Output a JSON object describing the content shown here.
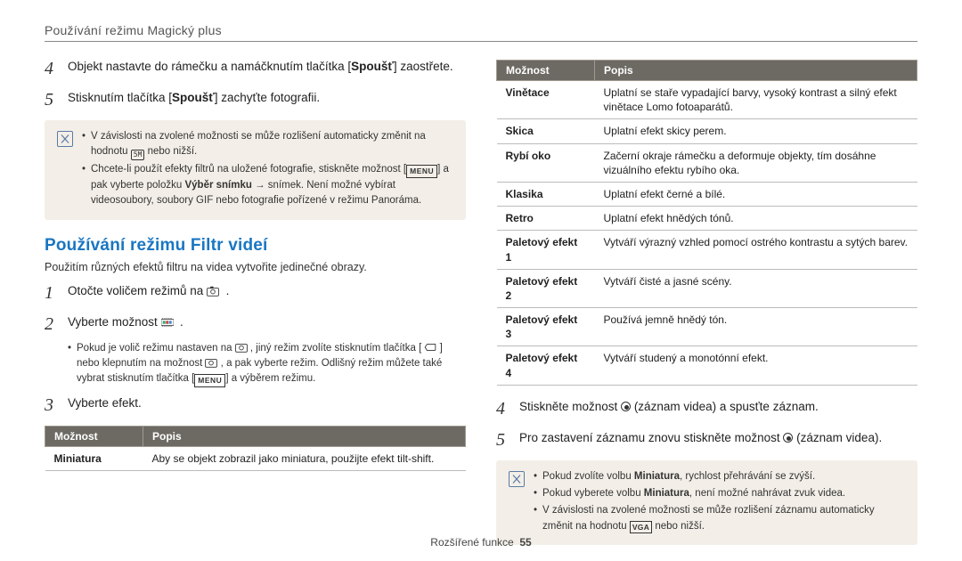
{
  "header": "Používání režimu Magický plus",
  "left": {
    "step4": {
      "pre": "Objekt nastavte do rámečku a namáčknutím tlačítka [",
      "bold": "Spoušť",
      "post": "] zaostřete."
    },
    "step5": {
      "pre": "Stisknutím tlačítka [",
      "bold": "Spoušť",
      "post": "] zachyťte fotografii."
    },
    "note1_a": "V závislosti na zvolené možnosti se může rozlišení automaticky změnit na hodnotu ",
    "note1_a_icon": "5M",
    "note1_a_post": " nebo nižší.",
    "note1_b_pre": "Chcete-li použít efekty filtrů na uložené fotografie, stiskněte možnost [",
    "note1_b_menu": "MENU",
    "note1_b_mid": "] a pak vyberte položku ",
    "note1_b_bold": "Výběr snímku",
    "note1_b_post": " → snímek. Není možné vybírat videosoubory, soubory GIF nebo fotografie pořízené v režimu Panoráma.",
    "section_title": "Používání režimu Filtr videí",
    "section_desc": "Použitím různých efektů filtru na videa vytvořite jedinečné obrazy.",
    "step1": "Otočte voličem režimů na ",
    "step2": "Vyberte možnost ",
    "step2_bullet": "Pokud je volič režimu nastaven na        , jiný režim zvolíte stisknutím tlačítka [        ] nebo klepnutím na možnost        , a pak vyberte režim. Odlišný režim můžete také vybrat stisknutím tlačítka [",
    "step2_bullet_menu": "MENU",
    "step2_bullet_post": "] a výběrem režimu.",
    "step3": "Vyberte efekt.",
    "table_h1": "Možnost",
    "table_h2": "Popis",
    "row_min_k": "Miniatura",
    "row_min_v": "Aby se objekt zobrazil jako miniatura, použijte efekt tilt-shift."
  },
  "right": {
    "table_h1": "Možnost",
    "table_h2": "Popis",
    "rows": [
      {
        "k": "Vinětace",
        "v": "Uplatní se staře vypadající barvy, vysoký kontrast a silný efekt vinětace Lomo fotoaparátů."
      },
      {
        "k": "Skica",
        "v": "Uplatní efekt skicy perem."
      },
      {
        "k": "Rybí oko",
        "v": "Začerní okraje rámečku a deformuje objekty, tím dosáhne vizuálního efektu rybího oka."
      },
      {
        "k": "Klasika",
        "v": "Uplatní efekt černé a bílé."
      },
      {
        "k": "Retro",
        "v": "Uplatní efekt hnědých tónů."
      },
      {
        "k": "Paletový efekt 1",
        "v": "Vytváří výrazný vzhled pomocí ostrého kontrastu a sytých barev."
      },
      {
        "k": "Paletový efekt 2",
        "v": "Vytváří čisté a jasné scény."
      },
      {
        "k": "Paletový efekt 3",
        "v": "Používá jemně hnědý tón."
      },
      {
        "k": "Paletový efekt 4",
        "v": "Vytváří studený a monotónní efekt."
      }
    ],
    "step4_pre": "Stiskněte možnost ",
    "step4_post": " (záznam videa) a spusťte záznam.",
    "step5_pre": "Pro zastavení záznamu znovu stiskněte možnost ",
    "step5_post": " (záznam videa).",
    "note_a": "Pokud zvolíte volbu ",
    "note_a_b": "Miniatura",
    "note_a_post": ", rychlost přehrávání se zvýší.",
    "note_b": "Pokud vyberete volbu ",
    "note_b_b": "Miniatura",
    "note_b_post": ", není možné nahrávat zvuk videa.",
    "note_c": "V závislosti na zvolené možnosti se může rozlišení záznamu automaticky změnit na hodnotu ",
    "note_c_icon": "VGA",
    "note_c_post": " nebo nižší."
  },
  "footer_label": "Rozšířené funkce",
  "footer_page": "55"
}
